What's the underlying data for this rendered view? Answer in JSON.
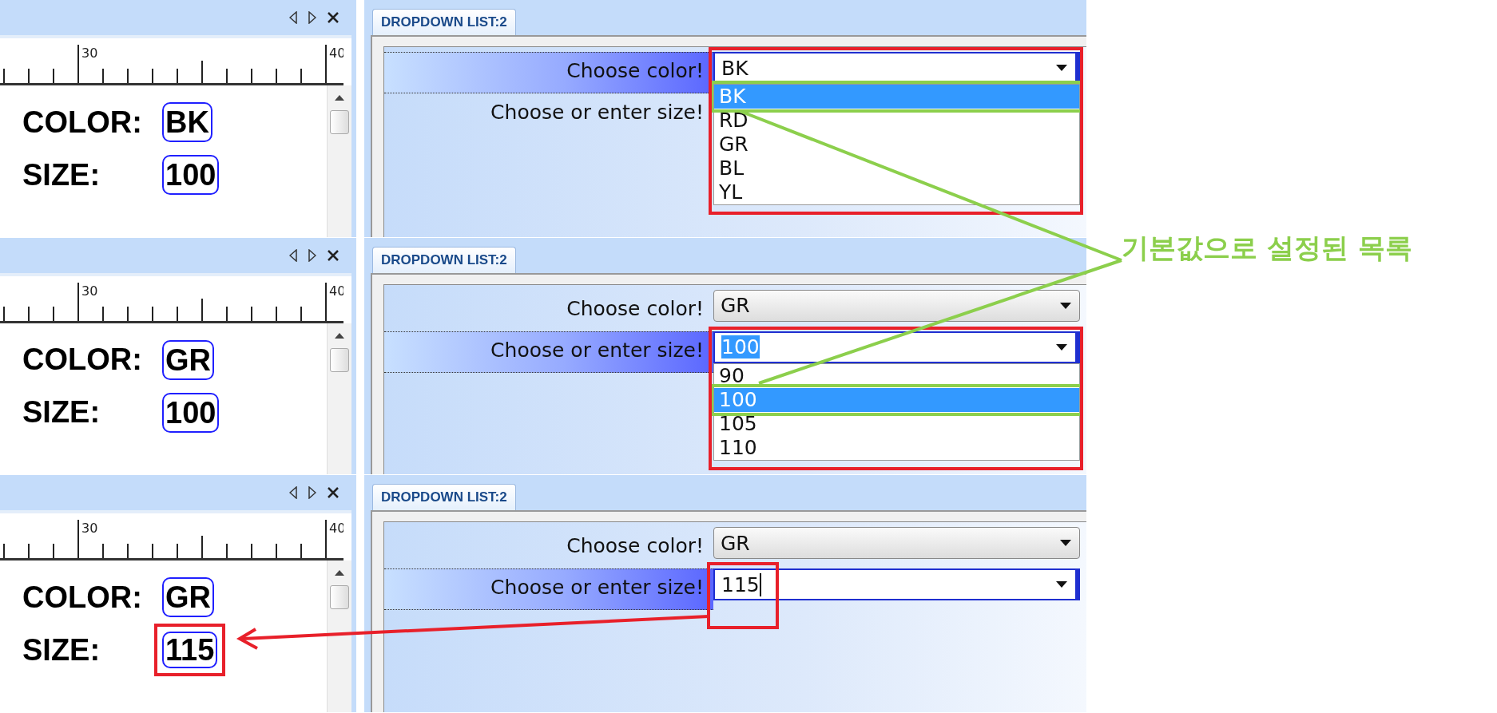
{
  "panels": [
    {
      "tab": "DROPDOWN LIST:2",
      "ruler_labels": [
        "30",
        "40"
      ],
      "preview": [
        {
          "label": "COLOR:",
          "value": "BK",
          "callout": false
        },
        {
          "label": "SIZE:",
          "value": "100",
          "callout": false
        }
      ],
      "fields": [
        {
          "label": "Choose color!",
          "active": true,
          "value": "BK",
          "callout": true,
          "options": [
            {
              "text": "BK",
              "selected": true
            },
            {
              "text": "RD",
              "selected": false
            },
            {
              "text": "GR",
              "selected": false
            },
            {
              "text": "BL",
              "selected": false
            },
            {
              "text": "YL",
              "selected": false
            }
          ]
        },
        {
          "label": "Choose or enter size!",
          "active": false
        }
      ]
    },
    {
      "tab": "DROPDOWN LIST:2",
      "ruler_labels": [
        "30",
        "40"
      ],
      "preview": [
        {
          "label": "COLOR:",
          "value": "GR",
          "callout": false
        },
        {
          "label": "SIZE:",
          "value": "100",
          "callout": false
        }
      ],
      "fields": [
        {
          "label": "Choose color!",
          "active": false,
          "value": "GR"
        },
        {
          "label": "Choose or enter size!",
          "active": true,
          "value": "100",
          "text_selected": true,
          "callout": true,
          "options": [
            {
              "text": "90",
              "selected": false
            },
            {
              "text": "100",
              "selected": true
            },
            {
              "text": "105",
              "selected": false
            },
            {
              "text": "110",
              "selected": false
            }
          ]
        }
      ]
    },
    {
      "tab": "DROPDOWN LIST:2",
      "ruler_labels": [
        "30",
        "40"
      ],
      "preview": [
        {
          "label": "COLOR:",
          "value": "GR",
          "callout": false
        },
        {
          "label": "SIZE:",
          "value": "115",
          "callout": true
        }
      ],
      "fields": [
        {
          "label": "Choose color!",
          "active": false,
          "value": "GR"
        },
        {
          "label": "Choose or enter size!",
          "active": true,
          "value": "115",
          "caret": true,
          "callout": true
        }
      ]
    }
  ],
  "annotation": {
    "text": "기본값으로 설정된 목록"
  }
}
